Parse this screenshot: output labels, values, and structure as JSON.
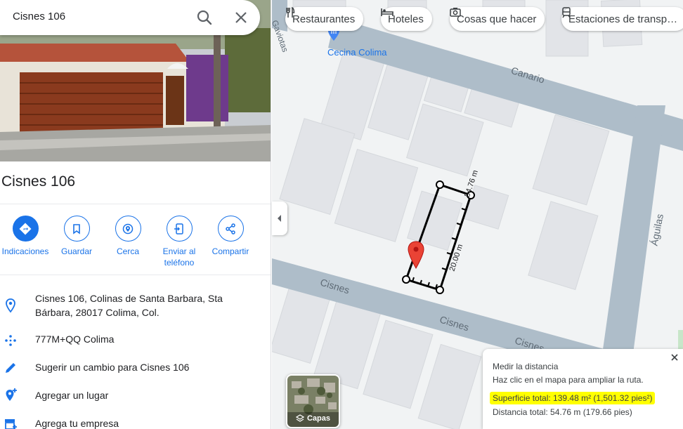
{
  "search": {
    "value": "Cisnes 106"
  },
  "place": {
    "title": "Cisnes 106",
    "actions": [
      {
        "label": "Indicaciones",
        "icon": "directions-icon"
      },
      {
        "label": "Guardar",
        "icon": "bookmark-icon"
      },
      {
        "label": "Cerca",
        "icon": "nearby-icon"
      },
      {
        "label": "Enviar al teléfono",
        "icon": "send-to-phone-icon"
      },
      {
        "label": "Compartir",
        "icon": "share-icon"
      }
    ],
    "address_line1": "Cisnes 106, Colinas de Santa Barbara, Sta",
    "address_line2": "Bárbara, 28017 Colima, Col.",
    "plus_code": "777M+QQ Colima",
    "suggest_edit": "Sugerir un cambio para Cisnes 106",
    "add_place": "Agregar un lugar",
    "add_business": "Agrega tu empresa"
  },
  "map": {
    "chips": [
      {
        "label": "Restaurantes",
        "icon": "restaurant-icon"
      },
      {
        "label": "Hoteles",
        "icon": "hotel-icon"
      },
      {
        "label": "Cosas que hacer",
        "icon": "camera-icon"
      },
      {
        "label": "Estaciones de transp…",
        "icon": "train-icon"
      }
    ],
    "poi_label": "Cecina Colima",
    "streets": {
      "canario": "Canario",
      "aguilas": "Águilas",
      "cisnes": "Cisnes"
    },
    "measure_labels": {
      "long_side": "54.76 m",
      "short_side": "20.00 m"
    },
    "layers_label": "Capas"
  },
  "measure_panel": {
    "title": "Medir la distancia",
    "hint": "Haz clic en el mapa para ampliar la ruta.",
    "area": "Superficie total: 139.48 m² (1,501.32 pies²)",
    "distance": "Distancia total: 54.76 m (179.66 pies)"
  },
  "colors": {
    "accent": "#1a73e8",
    "road": "#aebdc9",
    "highlight": "#ffff00",
    "pin": "#ea4335"
  }
}
